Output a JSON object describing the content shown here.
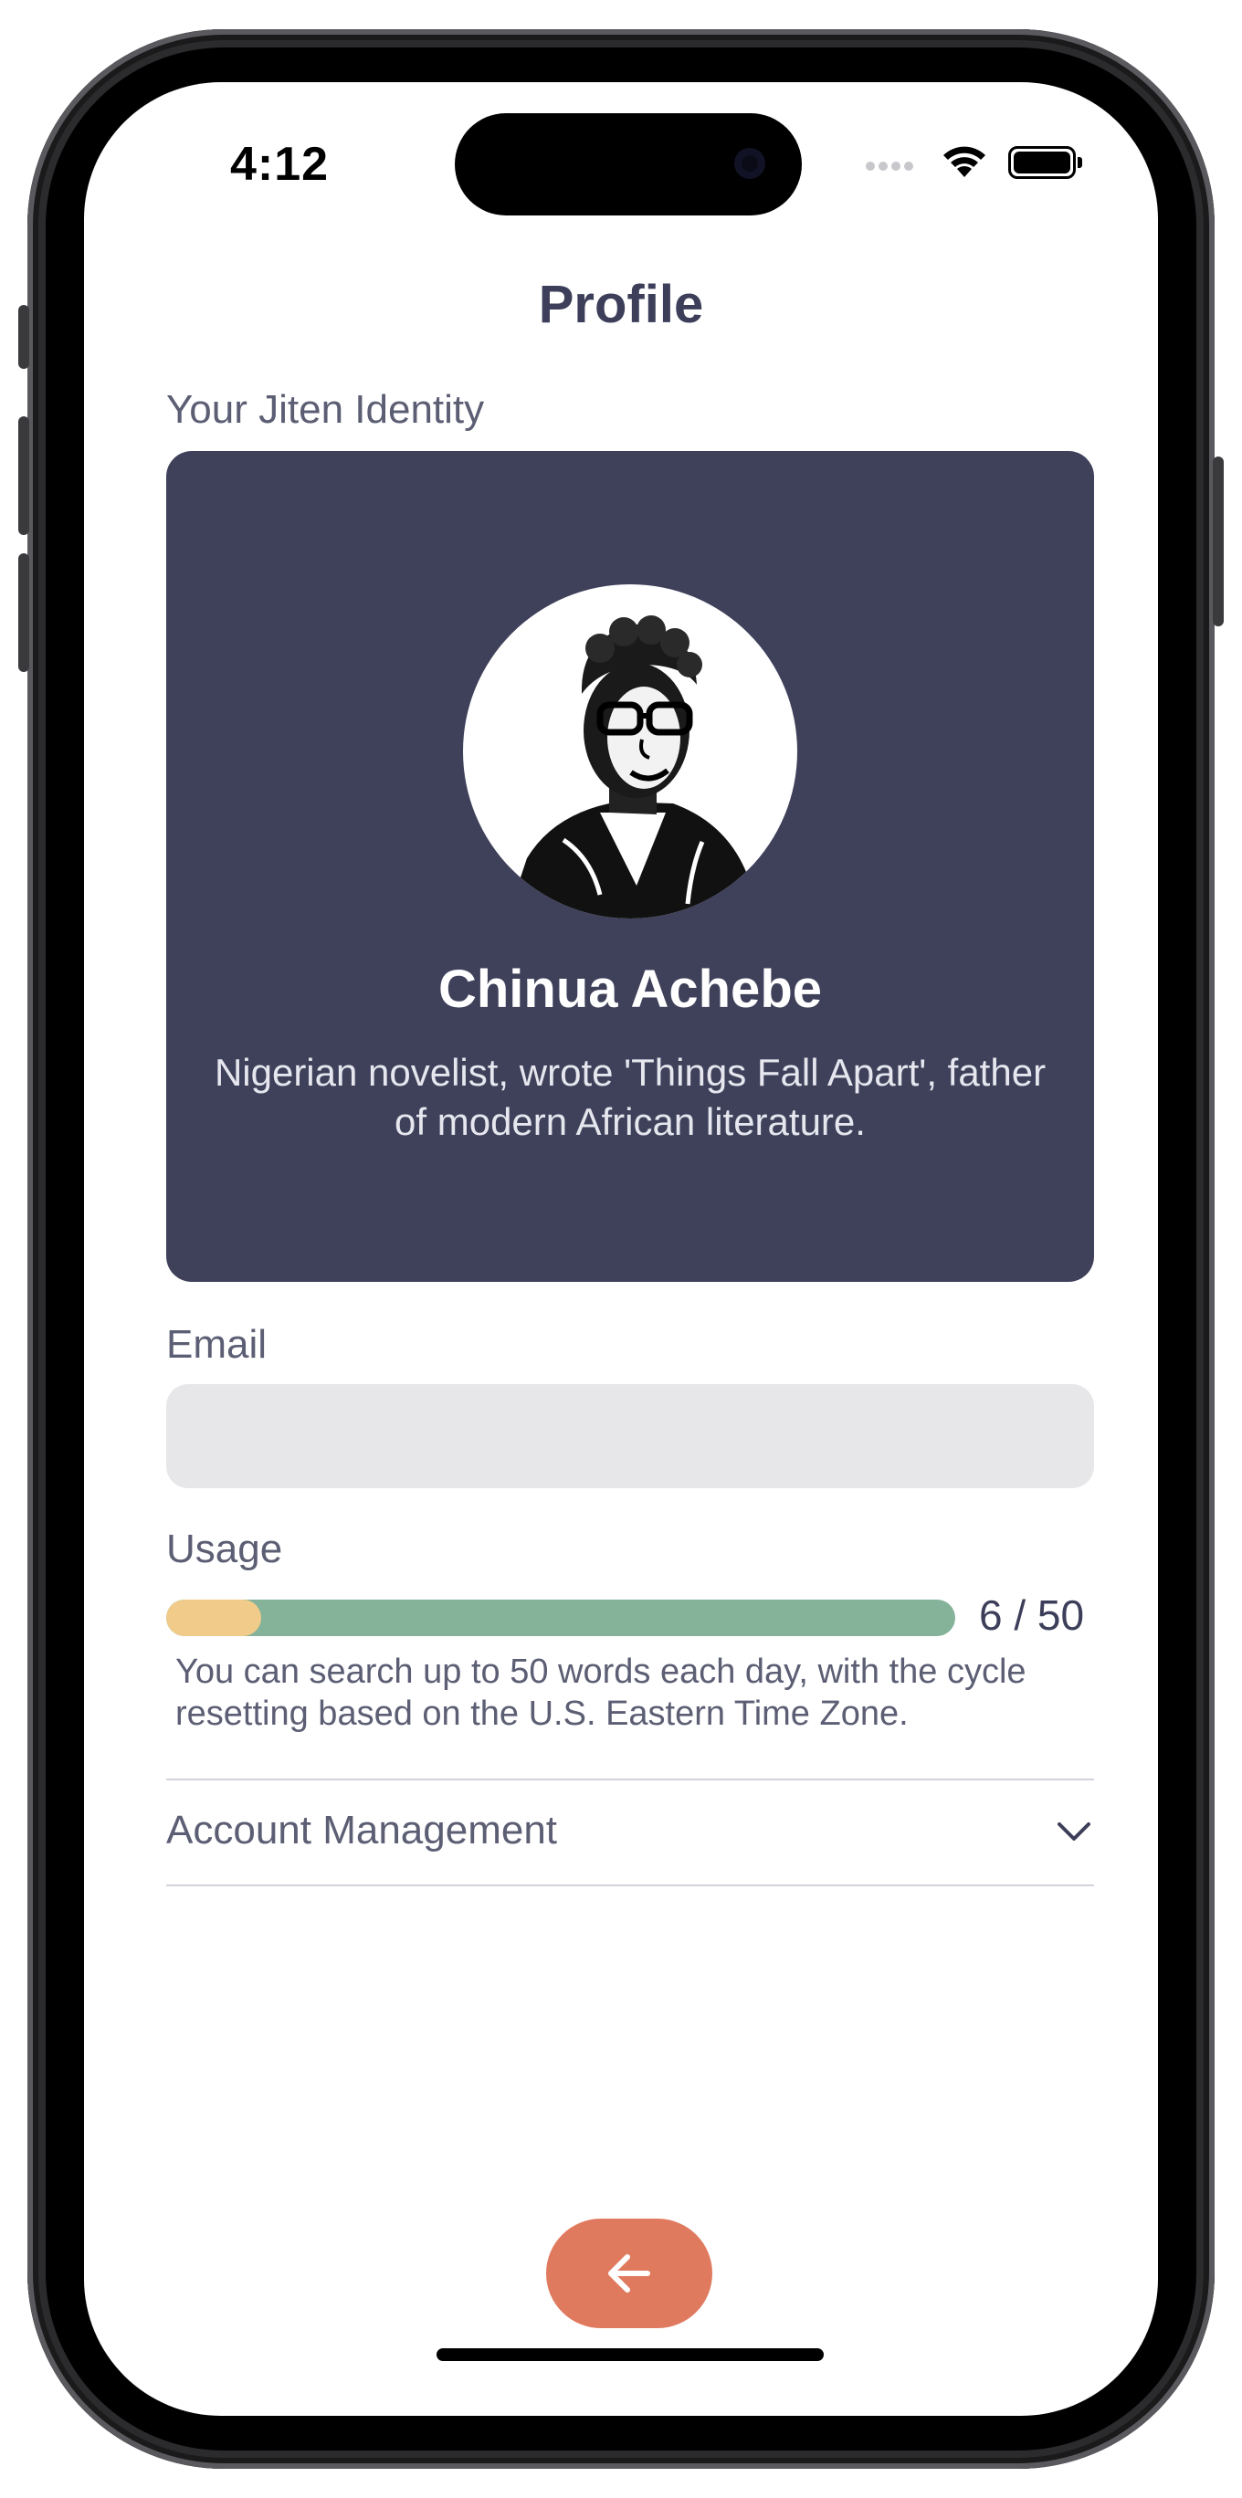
{
  "status_bar": {
    "time": "4:12"
  },
  "header": {
    "title": "Profile"
  },
  "identity": {
    "section_label": "Your Jiten Identity",
    "name": "Chinua Achebe",
    "description": "Nigerian novelist, wrote 'Things Fall Apart', father of modern African literature.",
    "avatar_icon": "portrait-illustration"
  },
  "email": {
    "label": "Email",
    "value": "",
    "placeholder": ""
  },
  "usage": {
    "label": "Usage",
    "used": 6,
    "limit": 50,
    "count_text": "6 / 50",
    "note": "You can search up to 50 words each day, with the cycle resetting based on the U.S. Eastern Time Zone.",
    "fill_color": "#f1cb8a",
    "track_color": "#84b39a"
  },
  "account": {
    "label": "Account Management",
    "icon": "chevron-down-icon"
  },
  "navigation": {
    "back_icon": "arrow-left-icon",
    "back_color": "#e07a5f"
  },
  "colors": {
    "card_background": "#3f415b",
    "title": "#3d3f5a"
  }
}
